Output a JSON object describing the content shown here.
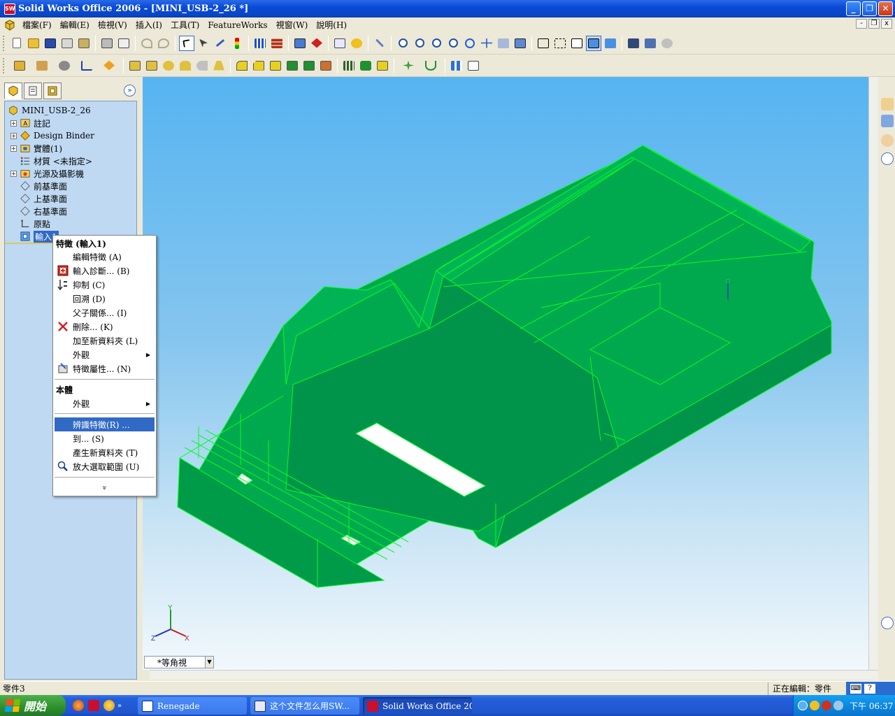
{
  "window": {
    "title": "Solid Works Office 2006 - [MINI_USB-2_26 *]",
    "app_icon_text": "SW",
    "buttons": [
      "_",
      "❐",
      "✕"
    ]
  },
  "menubar": {
    "items": [
      "檔案(F)",
      "編輯(E)",
      "檢視(V)",
      "插入(I)",
      "工具(T)",
      "FeatureWorks",
      "視窗(W)",
      "說明(H)"
    ],
    "mdi_buttons": [
      "-",
      "❐",
      "x"
    ]
  },
  "toolbar1": {
    "icons": [
      "new-icon",
      "open-icon",
      "save-icon",
      "print-setup-icon",
      "options-icon",
      "print-icon",
      "print-preview-icon",
      "undo-icon",
      "redo-icon",
      "select-icon",
      "select-edge-icon",
      "sketch-icon",
      "rebuild-icon",
      "grid-icon",
      "texture-icon",
      "dimension-icon",
      "smart-icon",
      "list-icon",
      "help-icon",
      "measure-icon",
      "zoom-fit-icon",
      "zoom-area-icon",
      "zoom-inout-icon",
      "zoom-selection-icon",
      "rotate-icon",
      "pan-icon",
      "3d-icon",
      "view-orientation-icon",
      "wireframe-icon",
      "hidden-lines-icon",
      "hidden-removed-icon",
      "shaded-edges-icon",
      "shaded-icon",
      "shadow-icon",
      "section-icon",
      "render-icon"
    ]
  },
  "toolbar2": {
    "icons": [
      "assembly-icon",
      "sketch-relations-icon",
      "settings-icon",
      "sketch-line-icon",
      "plane-icon",
      "extrude-icon",
      "cut-icon",
      "revolve-icon",
      "sweep-icon",
      "loft-icon",
      "shell-icon",
      "fillet-icon",
      "chamfer-icon",
      "draft-icon",
      "rib-icon",
      "dome-icon",
      "wrap-icon",
      "pattern-icon",
      "mirror-icon",
      "linear-pattern-icon",
      "reference-icon",
      "curves-icon",
      "ribbon-grid-icon",
      "checklist-icon"
    ]
  },
  "feature_manager": {
    "tabs": [
      "feature-tree-tab-icon",
      "property-tab-icon",
      "config-tab-icon"
    ],
    "collapse": "»",
    "root": "MINI_USB-2_26",
    "items": [
      {
        "label": "註記",
        "icon": "annotations-icon",
        "expandable": true
      },
      {
        "label": "Design Binder",
        "icon": "design-binder-icon",
        "expandable": true
      },
      {
        "label": "實體(1)",
        "icon": "solid-bodies-icon",
        "expandable": true
      },
      {
        "label": "材質 <未指定>",
        "icon": "material-icon",
        "expandable": false
      },
      {
        "label": "光源及攝影機",
        "icon": "lights-cameras-icon",
        "expandable": true
      },
      {
        "label": "前基準面",
        "icon": "plane-icon",
        "expandable": false
      },
      {
        "label": "上基準面",
        "icon": "plane-icon",
        "expandable": false
      },
      {
        "label": "右基準面",
        "icon": "plane-icon",
        "expandable": false
      },
      {
        "label": "原點",
        "icon": "origin-icon",
        "expandable": false
      },
      {
        "label": "輸入1",
        "icon": "imported-body-icon",
        "expandable": false,
        "selected": true
      }
    ]
  },
  "context_menu": {
    "section1_title": "特徵 (輸入1)",
    "section1_items": [
      {
        "label": "編輯特徵 (A)",
        "icon": ""
      },
      {
        "label": "輸入診斷... (B)",
        "icon": "import-diagnostics-icon"
      },
      {
        "label": "抑制 (C)",
        "icon": "suppress-icon"
      },
      {
        "label": "回溯 (D)",
        "icon": ""
      },
      {
        "label": "父子關係... (I)",
        "icon": ""
      },
      {
        "label": "刪除... (K)",
        "icon": "delete-icon"
      },
      {
        "label": "加至新資料夾 (L)",
        "icon": ""
      },
      {
        "label": "外觀",
        "icon": "",
        "submenu": true
      },
      {
        "label": "特徵屬性... (N)",
        "icon": "feature-properties-icon"
      }
    ],
    "section2_title": "本體",
    "section2_items": [
      {
        "label": "外觀",
        "icon": "",
        "submenu": true
      }
    ],
    "section3_items": [
      {
        "label": "辨識特徵(R) ...",
        "icon": "",
        "highlighted": true
      },
      {
        "label": "到... (S)",
        "icon": ""
      },
      {
        "label": "產生新資料夾 (T)",
        "icon": ""
      },
      {
        "label": "放大選取範圍 (U)",
        "icon": "zoom-selection-icon"
      }
    ],
    "expand": "»",
    "submenu_arrow": "▶"
  },
  "viewport": {
    "view_selector": "*等角視",
    "view_arrow": "▼",
    "triad": {
      "x": "X",
      "y": "Y",
      "z": "Z"
    }
  },
  "right_taskpane": {
    "icons": [
      "home-icon",
      "library-icon",
      "search-icon",
      "collapse-left-icon",
      "collapse-bottom-icon"
    ]
  },
  "statusbar": {
    "left": "零件3",
    "right": "正在編輯：零件",
    "icons": [
      "keyboard-icon",
      "help-icon"
    ]
  },
  "taskbar": {
    "start_label": "開始",
    "quicklaunch": [
      "firefox-icon",
      "solidworks-icon",
      "media-icon"
    ],
    "ql_more": "»",
    "tasks": [
      {
        "label": "Renegade",
        "icon": "window-icon"
      },
      {
        "label": "这个文件怎么用SW...",
        "icon": "document-icon"
      },
      {
        "label": "Solid Works Office 20...",
        "icon": "solidworks-icon",
        "active": true
      }
    ],
    "tray_icons": [
      "arrow-icon",
      "shield-icon",
      "security-icon",
      "network-icon"
    ],
    "clock": "下午 06:37"
  },
  "colors": {
    "model_fill": "#00a84e",
    "model_edge": "#00ff20",
    "viewport_top": "#56b4f0",
    "viewport_bottom": "#f2f8fc",
    "selection": "#316ac5"
  }
}
